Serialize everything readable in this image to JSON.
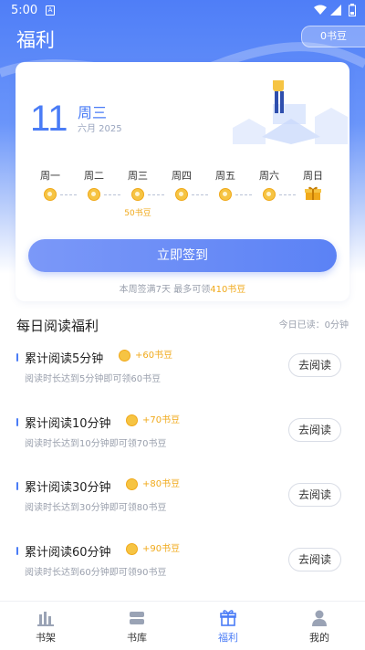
{
  "status_bar": {
    "time": "5:00"
  },
  "header": {
    "title": "福利",
    "coins": "0书豆"
  },
  "date_card": {
    "day": "11",
    "weekday": "周三",
    "month_year": "六月 2025",
    "week": [
      {
        "label": "周一",
        "icon": "coin-icon"
      },
      {
        "label": "周二",
        "icon": "coin-icon"
      },
      {
        "label": "周三",
        "icon": "coin-icon",
        "reward": "50书豆"
      },
      {
        "label": "周四",
        "icon": "coin-icon"
      },
      {
        "label": "周五",
        "icon": "coin-icon"
      },
      {
        "label": "周六",
        "icon": "coin-icon"
      },
      {
        "label": "周日",
        "icon": "gift-box-icon"
      }
    ],
    "signin_button": "立即签到",
    "hint_prefix": "本周签满7天 最多可领",
    "hint_amount": "410书豆"
  },
  "daily": {
    "title": "每日阅读福利",
    "today_read": "今日已读：0分钟",
    "tasks": [
      {
        "name": "累计阅读5分钟",
        "reward": "+60书豆",
        "desc": "阅读时长达到5分钟即可领60书豆",
        "button": "去阅读"
      },
      {
        "name": "累计阅读10分钟",
        "reward": "+70书豆",
        "desc": "阅读时长达到10分钟即可领70书豆",
        "button": "去阅读"
      },
      {
        "name": "累计阅读30分钟",
        "reward": "+80书豆",
        "desc": "阅读时长达到30分钟即可领80书豆",
        "button": "去阅读"
      },
      {
        "name": "累计阅读60分钟",
        "reward": "+90书豆",
        "desc": "阅读时长达到60分钟即可领90书豆",
        "button": "去阅读"
      }
    ]
  },
  "tabbar": {
    "tabs": [
      {
        "label": "书架",
        "icon": "bookshelf-icon"
      },
      {
        "label": "书库",
        "icon": "library-icon"
      },
      {
        "label": "福利",
        "icon": "gift-icon",
        "active": true
      },
      {
        "label": "我的",
        "icon": "profile-icon"
      }
    ]
  },
  "colors": {
    "accent": "#4a7cf6",
    "gold": "#f0a91a"
  }
}
